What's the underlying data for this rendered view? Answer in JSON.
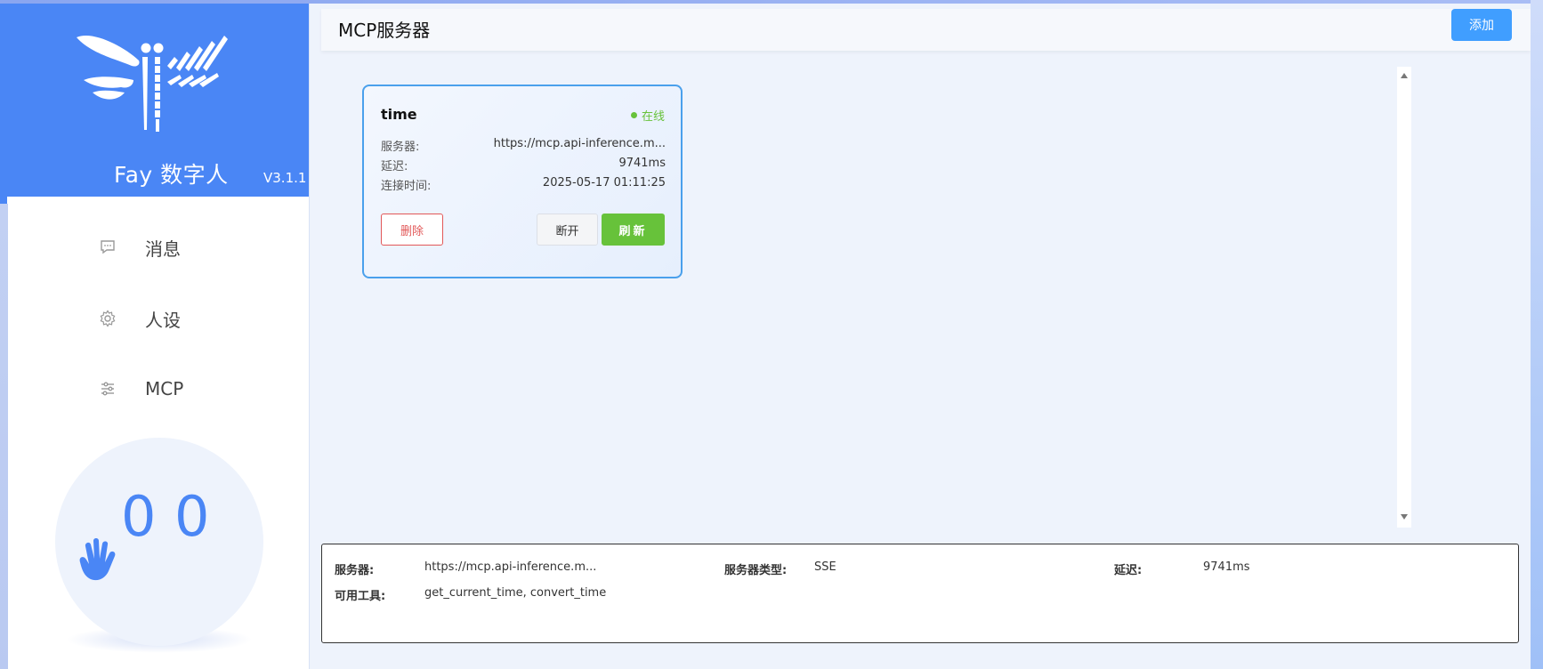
{
  "brand": {
    "name": "Fay 数字人",
    "version": "V3.1.1"
  },
  "sidebar": {
    "items": [
      {
        "label": "消息",
        "icon": "chat-bubble-icon"
      },
      {
        "label": "人设",
        "icon": "gear-icon"
      },
      {
        "label": "MCP",
        "icon": "sliders-icon"
      }
    ]
  },
  "bubble": {
    "left_digit": "0",
    "right_digit": "0",
    "icon": "waving-hand-icon"
  },
  "header": {
    "title": "MCP服务器",
    "add_label": "添加"
  },
  "card": {
    "name": "time",
    "status": "在线",
    "rows": [
      {
        "key": "服务器:",
        "value": "https://mcp.api-inference.m..."
      },
      {
        "key": "延迟:",
        "value": "9741ms"
      },
      {
        "key": "连接时间:",
        "value": "2025-05-17 01:11:25"
      }
    ],
    "delete_label": "删除",
    "disconnect_label": "断开",
    "refresh_label": "刷新"
  },
  "detail": {
    "server_key": "服务器:",
    "server_value": "https://mcp.api-inference.m...",
    "type_key": "服务器类型:",
    "type_value": "SSE",
    "latency_key": "延迟:",
    "latency_value": "9741ms",
    "tools_key": "可用工具:",
    "tools_value": "get_current_time, convert_time"
  },
  "colors": {
    "brand_blue": "#4a86f5",
    "primary": "#409eff",
    "success": "#67c23a",
    "danger": "#e25858"
  }
}
